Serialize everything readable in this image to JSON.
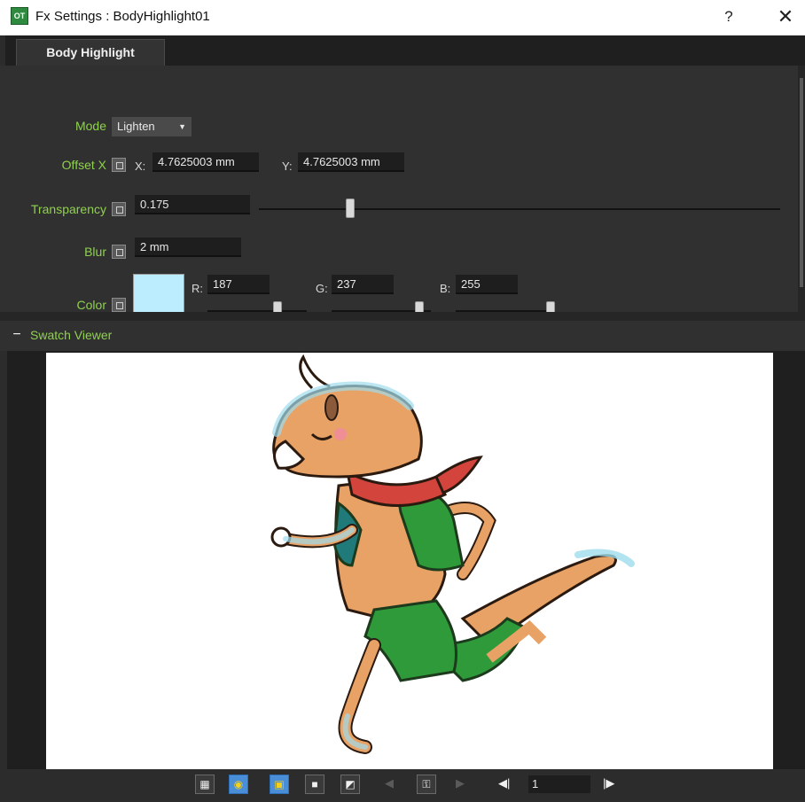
{
  "window": {
    "title": "Fx Settings : BodyHighlight01",
    "app_icon_text": "OT",
    "help_label": "?",
    "close_label": "✕"
  },
  "tabs": [
    {
      "label": "Body Highlight"
    }
  ],
  "params": {
    "mode": {
      "label": "Mode",
      "value": "Lighten"
    },
    "offset": {
      "label": "Offset X",
      "x_label": "X:",
      "x_value": "4.7625003 mm",
      "y_label": "Y:",
      "y_value": "4.7625003 mm"
    },
    "transparency": {
      "label": "Transparency",
      "value": "0.175",
      "slider_fraction": 0.175
    },
    "blur": {
      "label": "Blur",
      "value": "2 mm"
    },
    "color": {
      "label": "Color",
      "swatch_color": "#bbedff",
      "r_label": "R:",
      "r_value": "187",
      "g_label": "G:",
      "g_value": "237",
      "b_label": "B:",
      "b_value": "255"
    }
  },
  "swatch_viewer": {
    "collapse_label": "−",
    "title": "Swatch Viewer",
    "image_description": "running-dog-character-with-highlight"
  },
  "toolbar": {
    "frame_value": "1",
    "buttons": [
      {
        "name": "checkerboard-icon",
        "active": false
      },
      {
        "name": "eye-icon",
        "active": true
      },
      {
        "name": "white-bg-icon",
        "active": true
      },
      {
        "name": "black-bg-icon",
        "active": false
      },
      {
        "name": "checker-bg-icon",
        "active": false
      },
      {
        "name": "prev-frame-icon",
        "active": false
      },
      {
        "name": "key-icon",
        "active": false
      },
      {
        "name": "next-frame-icon",
        "active": false
      },
      {
        "name": "first-frame-icon",
        "active": false
      },
      {
        "name": "last-frame-icon",
        "active": false
      }
    ]
  },
  "colors": {
    "label_green": "#8fd14f",
    "panel_bg": "#2c2c2c",
    "active_blue": "#4b8ed8",
    "active_yellow": "#f2d01c"
  }
}
